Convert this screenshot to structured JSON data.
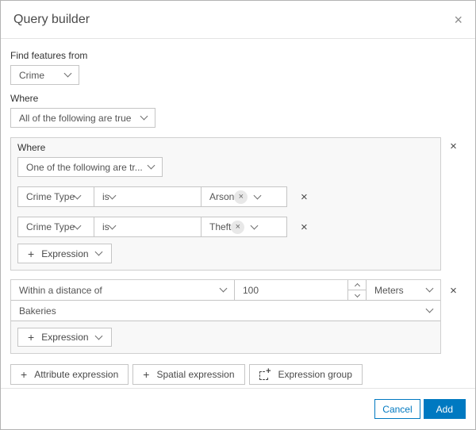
{
  "colors": {
    "accent": "#0079c1"
  },
  "icons": {
    "close": "×",
    "remove": "×",
    "plus": "+",
    "chip_remove": "×",
    "expression_group_plus": "+"
  },
  "dialog": {
    "title": "Query builder"
  },
  "find_features": {
    "label": "Find features from",
    "value": "Crime"
  },
  "where": {
    "label": "Where",
    "value": "All of the following are true"
  },
  "group1": {
    "label": "Where",
    "operator": "One of the following are tr...",
    "rows": [
      {
        "field": "Crime Type",
        "op": "is",
        "value": "Arson"
      },
      {
        "field": "Crime Type",
        "op": "is",
        "value": "Theft"
      }
    ],
    "add_expression_label": "Expression"
  },
  "group2": {
    "type": "Within a distance of",
    "distance": "100",
    "unit": "Meters",
    "layer": "Bakeries",
    "add_expression_label": "Expression"
  },
  "actions": {
    "attribute_expression": "Attribute expression",
    "spatial_expression": "Spatial expression",
    "expression_group": "Expression group"
  },
  "footer": {
    "cancel": "Cancel",
    "add": "Add"
  }
}
